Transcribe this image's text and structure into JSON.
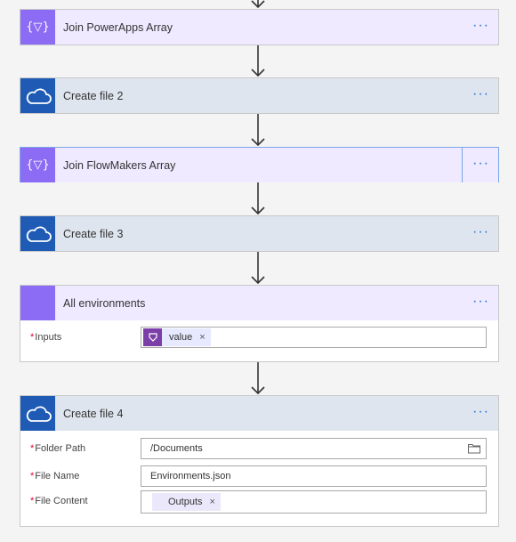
{
  "steps": {
    "join_powerapps": {
      "title": "Join PowerApps Array",
      "icon": "compose-icon"
    },
    "create_file_2": {
      "title": "Create file 2",
      "icon": "onedrive-cloud-icon"
    },
    "join_flowmakers": {
      "title": "Join FlowMakers Array",
      "icon": "compose-icon"
    },
    "create_file_3": {
      "title": "Create file 3",
      "icon": "onedrive-cloud-icon"
    },
    "all_environments": {
      "title": "All environments",
      "inputs_label": "Inputs",
      "token_value": "value"
    },
    "create_file_4": {
      "title": "Create file 4",
      "folder_path_label": "Folder Path",
      "folder_path_value": "/Documents",
      "file_name_label": "File Name",
      "file_name_value": "Environments.json",
      "file_content_label": "File Content",
      "file_content_token": "Outputs"
    }
  },
  "common": {
    "more_label": "···",
    "required_mark": "*",
    "remove_token_label": "×",
    "compose_glyph": "{▽}"
  },
  "colors": {
    "compose_purple": "#8c6cf4",
    "onedrive_blue": "#1f5bb5",
    "dynamic_token_purple": "#7b3fa7",
    "link_blue": "#1e6fd2"
  }
}
